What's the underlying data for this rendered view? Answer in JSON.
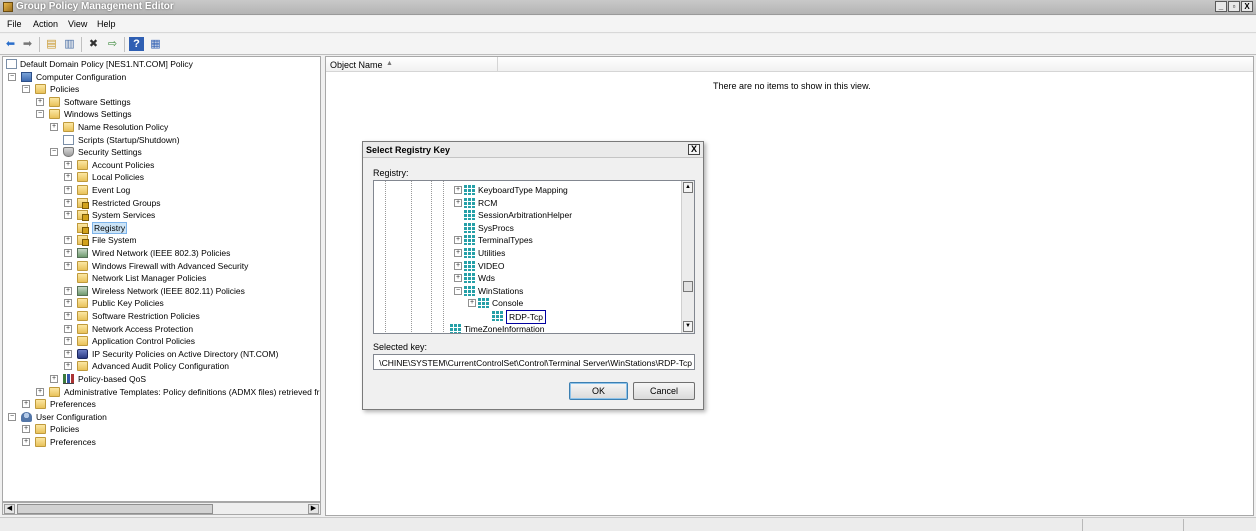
{
  "window": {
    "title": "Group Policy Management Editor",
    "buttons": [
      "_",
      "▫",
      "X"
    ]
  },
  "menu": [
    "File",
    "Action",
    "View",
    "Help"
  ],
  "toolbar": {
    "icons": [
      "back-icon",
      "forward-icon",
      "up-folder-icon",
      "show-hide-tree-icon",
      "delete-icon",
      "export-icon",
      "help-icon",
      "properties-icon"
    ]
  },
  "tree": [
    {
      "label": "Default Domain Policy [NES1.NT.COM] Policy",
      "icon": "doc"
    },
    {
      "label": "Computer Configuration",
      "icon": "pc",
      "exp": "−"
    },
    {
      "label": "Policies",
      "icon": "folder",
      "exp": "−"
    },
    {
      "label": "Software Settings",
      "icon": "folder",
      "exp": "+"
    },
    {
      "label": "Windows Settings",
      "icon": "folder",
      "exp": "−"
    },
    {
      "label": "Name Resolution Policy",
      "icon": "folder",
      "exp": "+"
    },
    {
      "label": "Scripts (Startup/Shutdown)",
      "icon": "doc",
      "exp": ""
    },
    {
      "label": "Security Settings",
      "icon": "shield",
      "exp": "−"
    },
    {
      "label": "Account Policies",
      "icon": "folder",
      "exp": "+"
    },
    {
      "label": "Local Policies",
      "icon": "folder",
      "exp": "+"
    },
    {
      "label": "Event Log",
      "icon": "folder",
      "exp": "+"
    },
    {
      "label": "Restricted Groups",
      "icon": "lockfolder",
      "exp": "+"
    },
    {
      "label": "System Services",
      "icon": "lockfolder",
      "exp": "+"
    },
    {
      "label": "Registry",
      "icon": "lockfolder",
      "exp": "",
      "selected": true
    },
    {
      "label": "File System",
      "icon": "lockfolder",
      "exp": "+"
    },
    {
      "label": "Wired Network (IEEE 802.3) Policies",
      "icon": "net",
      "exp": "+"
    },
    {
      "label": "Windows Firewall with Advanced Security",
      "icon": "folder",
      "exp": "+"
    },
    {
      "label": "Network List Manager Policies",
      "icon": "folder",
      "exp": ""
    },
    {
      "label": "Wireless Network (IEEE 802.11) Policies",
      "icon": "net",
      "exp": "+"
    },
    {
      "label": "Public Key Policies",
      "icon": "folder",
      "exp": "+"
    },
    {
      "label": "Software Restriction Policies",
      "icon": "folder",
      "exp": "+"
    },
    {
      "label": "Network Access Protection",
      "icon": "folder",
      "exp": "+"
    },
    {
      "label": "Application Control Policies",
      "icon": "folder",
      "exp": "+"
    },
    {
      "label": "IP Security Policies on Active Directory (NT.COM)",
      "icon": "ipsec",
      "exp": "+"
    },
    {
      "label": "Advanced Audit Policy Configuration",
      "icon": "folder",
      "exp": "+"
    },
    {
      "label": "Policy-based QoS",
      "icon": "chart",
      "exp": "+"
    },
    {
      "label": "Administrative Templates: Policy definitions (ADMX files) retrieved fr",
      "icon": "folder",
      "exp": "+"
    },
    {
      "label": "Preferences",
      "icon": "folder",
      "exp": "+"
    },
    {
      "label": "User Configuration",
      "icon": "user",
      "exp": "−"
    },
    {
      "label": "Policies",
      "icon": "folder",
      "exp": "+"
    },
    {
      "label": "Preferences",
      "icon": "folder",
      "exp": "+"
    }
  ],
  "list": {
    "column": "Object Name",
    "empty_message": "There are no items to show in this view."
  },
  "dialog": {
    "title": "Select Registry Key",
    "close": "X",
    "registry_label": "Registry:",
    "keys": [
      {
        "label": "KeyboardType Mapping",
        "exp": "+"
      },
      {
        "label": "RCM",
        "exp": "+"
      },
      {
        "label": "SessionArbitrationHelper",
        "exp": ""
      },
      {
        "label": "SysProcs",
        "exp": ""
      },
      {
        "label": "TerminalTypes",
        "exp": "+"
      },
      {
        "label": "Utilities",
        "exp": "+"
      },
      {
        "label": "VIDEO",
        "exp": "+"
      },
      {
        "label": "Wds",
        "exp": "+"
      },
      {
        "label": "WinStations",
        "exp": "−"
      },
      {
        "label": "Console",
        "exp": "+"
      },
      {
        "label": "RDP-Tcp",
        "exp": "",
        "selected": true
      },
      {
        "label": "TimeZoneInformation",
        "exp": ""
      }
    ],
    "selected_key_label": "Selected key:",
    "selected_key": "\\CHINE\\SYSTEM\\CurrentControlSet\\Control\\Terminal Server\\WinStations\\RDP-Tcp",
    "ok": "OK",
    "cancel": "Cancel"
  }
}
